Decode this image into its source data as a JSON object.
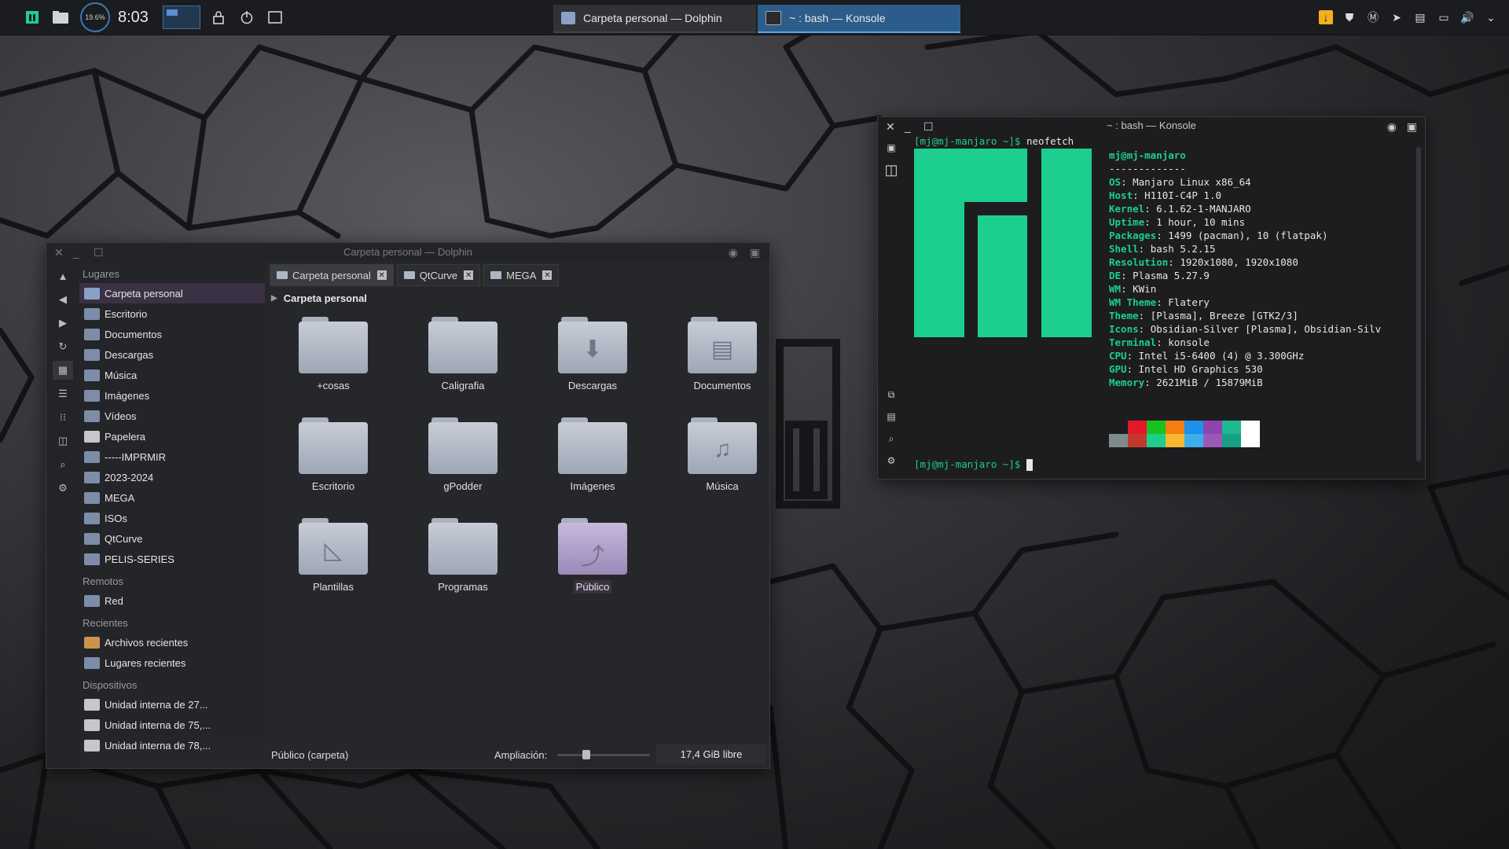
{
  "panel": {
    "cpu_load": "19.6%",
    "clock": "8:03",
    "tasks": [
      {
        "label": "Carpeta personal — Dolphin"
      },
      {
        "label": "~ : bash — Konsole"
      }
    ]
  },
  "dolphin": {
    "title": "Carpeta personal — Dolphin",
    "places": {
      "sections": [
        {
          "title": "Lugares",
          "items": [
            {
              "label": "Carpeta personal",
              "icon": "home-folder-icon",
              "selected": true
            },
            {
              "label": "Escritorio",
              "icon": "desktop-folder-icon"
            },
            {
              "label": "Documentos",
              "icon": "documents-folder-icon"
            },
            {
              "label": "Descargas",
              "icon": "downloads-folder-icon"
            },
            {
              "label": "Música",
              "icon": "music-folder-icon"
            },
            {
              "label": "Imágenes",
              "icon": "pictures-folder-icon"
            },
            {
              "label": "Vídeos",
              "icon": "videos-folder-icon"
            },
            {
              "label": "Papelera",
              "icon": "trash-icon"
            },
            {
              "label": "-----IMPRMIR",
              "icon": "folder-icon"
            },
            {
              "label": "2023-2024",
              "icon": "folder-icon"
            },
            {
              "label": "MEGA",
              "icon": "folder-icon"
            },
            {
              "label": "ISOs",
              "icon": "folder-icon"
            },
            {
              "label": "QtCurve",
              "icon": "folder-icon"
            },
            {
              "label": "PELIS-SERIES",
              "icon": "folder-icon"
            }
          ]
        },
        {
          "title": "Remotos",
          "items": [
            {
              "label": "Red",
              "icon": "network-folder-icon"
            }
          ]
        },
        {
          "title": "Recientes",
          "items": [
            {
              "label": "Archivos recientes",
              "icon": "recent-files-icon"
            },
            {
              "label": "Lugares recientes",
              "icon": "recent-places-icon"
            }
          ]
        },
        {
          "title": "Dispositivos",
          "items": [
            {
              "label": "Unidad interna de 27...",
              "icon": "drive-icon"
            },
            {
              "label": "Unidad interna de 75,...",
              "icon": "drive-icon"
            },
            {
              "label": "Unidad interna de 78,...",
              "icon": "drive-icon"
            }
          ]
        }
      ]
    },
    "tabs": [
      {
        "label": "Carpeta personal",
        "active": true
      },
      {
        "label": "QtCurve"
      },
      {
        "label": "MEGA"
      }
    ],
    "breadcrumb": "Carpeta personal",
    "files": [
      {
        "label": "+cosas",
        "icon": "folder-icon"
      },
      {
        "label": "Caligrafia",
        "icon": "folder-icon"
      },
      {
        "label": "Descargas",
        "icon": "downloads-folder-icon",
        "glyph": "⬇"
      },
      {
        "label": "Documentos",
        "icon": "documents-folder-icon",
        "glyph": "▤"
      },
      {
        "label": "Escritorio",
        "icon": "desktop-folder-icon"
      },
      {
        "label": "gPodder",
        "icon": "folder-icon"
      },
      {
        "label": "Imágenes",
        "icon": "pictures-folder-icon"
      },
      {
        "label": "Música",
        "icon": "music-folder-icon",
        "glyph": "♫"
      },
      {
        "label": "Plantillas",
        "icon": "templates-folder-icon",
        "glyph": "◺"
      },
      {
        "label": "Programas",
        "icon": "folder-icon"
      },
      {
        "label": "Público",
        "icon": "public-folder-icon",
        "glyph": "⤴",
        "selected": true
      }
    ],
    "status": {
      "selection": "Público (carpeta)",
      "zoom_label": "Ampliación:",
      "zoom_level": 0.3,
      "free_space": "17,4 GiB libre"
    }
  },
  "konsole": {
    "title": "~ : bash — Konsole",
    "prompt": "[mj@mj-manjaro ~]$",
    "command": "neofetch",
    "userhost": "mj@mj-manjaro",
    "separator": "-------------",
    "info": [
      {
        "key": "OS",
        "value": "Manjaro Linux x86_64"
      },
      {
        "key": "Host",
        "value": "H110I-C4P 1.0"
      },
      {
        "key": "Kernel",
        "value": "6.1.62-1-MANJARO"
      },
      {
        "key": "Uptime",
        "value": "1 hour, 10 mins"
      },
      {
        "key": "Packages",
        "value": "1499 (pacman), 10 (flatpak)"
      },
      {
        "key": "Shell",
        "value": "bash 5.2.15"
      },
      {
        "key": "Resolution",
        "value": "1920x1080, 1920x1080"
      },
      {
        "key": "DE",
        "value": "Plasma 5.27.9"
      },
      {
        "key": "WM",
        "value": "KWin"
      },
      {
        "key": "WM Theme",
        "value": "Flatery"
      },
      {
        "key": "Theme",
        "value": "[Plasma], Breeze [GTK2/3]"
      },
      {
        "key": "Icons",
        "value": "Obsidian-Silver [Plasma], Obsidian-Silv"
      },
      {
        "key": "Terminal",
        "value": "konsole"
      },
      {
        "key": "CPU",
        "value": "Intel i5-6400 (4) @ 3.300GHz"
      },
      {
        "key": "GPU",
        "value": "Intel HD Graphics 530"
      },
      {
        "key": "Memory",
        "value": "2621MiB / 15879MiB"
      }
    ],
    "palette_top": [
      "#1d1d1f",
      "#e5172a",
      "#19c21e",
      "#f27e14",
      "#1e8fea",
      "#8e44ad",
      "#1fb890",
      "#ffffff"
    ],
    "palette_bottom": [
      "#7f8c8d",
      "#c0392b",
      "#1ccf8f",
      "#f7b731",
      "#3daee9",
      "#9b59b6",
      "#16a085",
      "#ffffff"
    ],
    "logo_color": "#1ccf8f"
  }
}
